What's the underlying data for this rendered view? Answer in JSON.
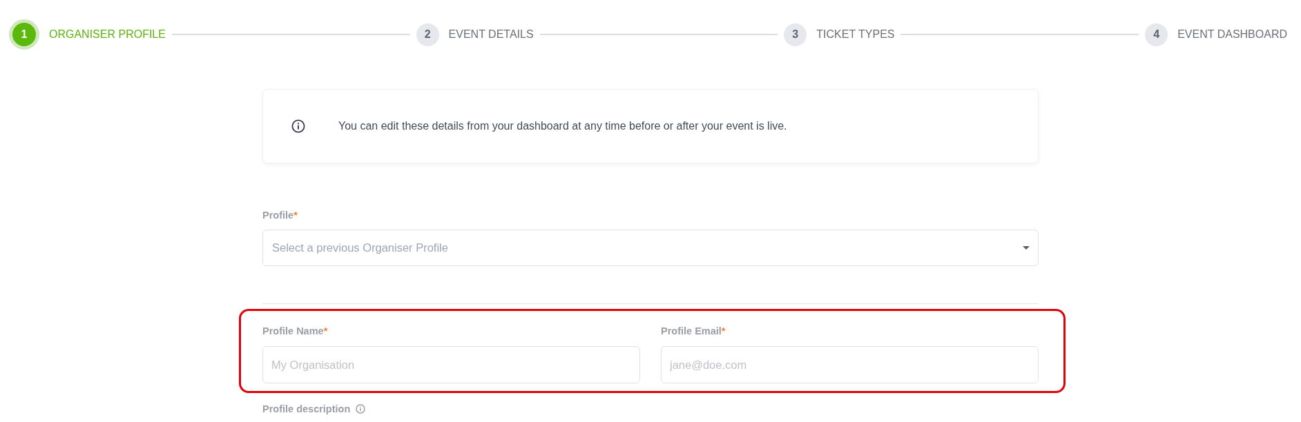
{
  "stepper": {
    "steps": [
      {
        "number": "1",
        "label": "ORGANISER PROFILE",
        "selected": true
      },
      {
        "number": "2",
        "label": "EVENT DETAILS",
        "selected": false
      },
      {
        "number": "3",
        "label": "TICKET TYPES",
        "selected": false
      },
      {
        "number": "4",
        "label": "EVENT DASHBOARD",
        "selected": false
      }
    ]
  },
  "notice": {
    "text": "You can edit these details from your dashboard at any time before or after your event is live."
  },
  "form": {
    "profile": {
      "label": "Profile",
      "required_mark": "*",
      "placeholder": "Select a previous Organiser Profile"
    },
    "highlighted_fields": [
      {
        "label": "Profile Name",
        "required_mark": "*",
        "placeholder": "My Organisation"
      },
      {
        "label": "Profile Email",
        "required_mark": "*",
        "placeholder": "jane@doe.com"
      }
    ],
    "description": {
      "label": "Profile description"
    }
  }
}
